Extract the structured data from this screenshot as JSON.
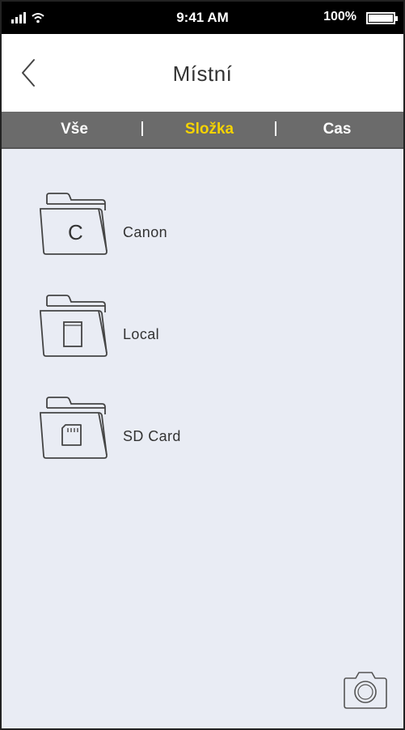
{
  "status_bar": {
    "time": "9:41 AM",
    "battery_text": "100%",
    "signal_icon": "signal-wifi-icon",
    "battery_icon": "battery-icon"
  },
  "header": {
    "title": "Místní",
    "back_icon": "chevron-left-icon"
  },
  "tabs": [
    {
      "label": "Vše",
      "active": false
    },
    {
      "label": "Složka",
      "active": true
    },
    {
      "label": "Cas",
      "active": false
    }
  ],
  "folders": [
    {
      "label": "Canon",
      "icon": "folder-canon-icon",
      "glyph": "C"
    },
    {
      "label": "Local",
      "icon": "folder-local-icon"
    },
    {
      "label": "SD Card",
      "icon": "folder-sdcard-icon"
    }
  ],
  "camera_button": {
    "icon": "camera-icon"
  },
  "colors": {
    "active_tab": "#f5d300",
    "tab_bar": "#6b6b6b",
    "background": "#e9ecf4"
  }
}
